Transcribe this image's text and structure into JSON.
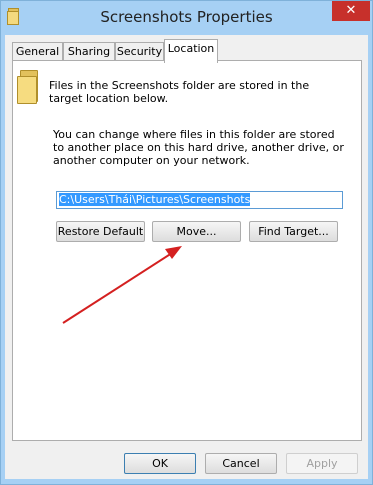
{
  "window": {
    "title": "Screenshots Properties",
    "close_glyph": "✕"
  },
  "tabs": [
    {
      "label": "General"
    },
    {
      "label": "Sharing"
    },
    {
      "label": "Security"
    },
    {
      "label": "Location",
      "active": true
    }
  ],
  "location": {
    "info": "Files in the Screenshots folder are stored in the target location below.",
    "description": "You can change where files in this folder are stored to another place on this hard drive, another drive, or another computer on your network.",
    "path": "C:\\Users\\Thái\\Pictures\\Screenshots",
    "restore_default_label": "Restore Default",
    "move_label": "Move...",
    "find_target_label": "Find Target..."
  },
  "footer": {
    "ok_label": "OK",
    "cancel_label": "Cancel",
    "apply_label": "Apply",
    "apply_enabled": false
  },
  "colors": {
    "title_bar": "#a6d0f4",
    "close_button": "#c7302b",
    "selection": "#3399ff",
    "annotation_arrow": "#d42020"
  },
  "icons": [
    "folder-icon",
    "window-folder-icon",
    "close-icon"
  ]
}
